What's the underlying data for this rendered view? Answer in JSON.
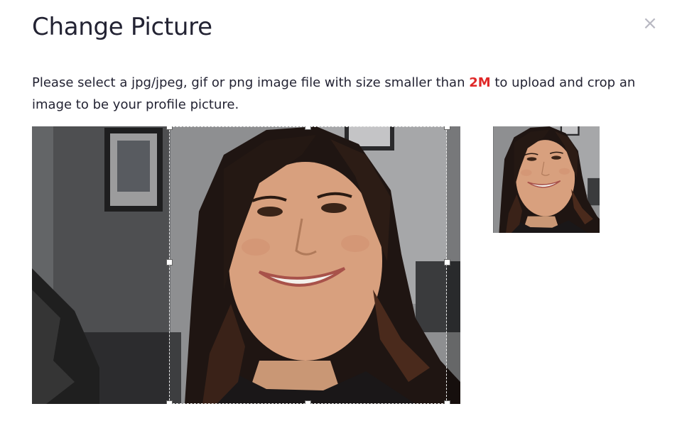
{
  "dialog": {
    "title": "Change Picture",
    "close_glyph": "×",
    "description_before": "Please select a jpg/jpeg, gif or png image file with size smaller than ",
    "description_highlight": "2M",
    "description_after": " to upload and crop an image to be your profile picture.",
    "highlight_color": "#e02828"
  },
  "cropper": {
    "image_alt": "Photo of a smiling woman with long dark hair",
    "preview_alt": "Cropped profile picture preview"
  },
  "icons": {
    "close": "close-icon"
  }
}
